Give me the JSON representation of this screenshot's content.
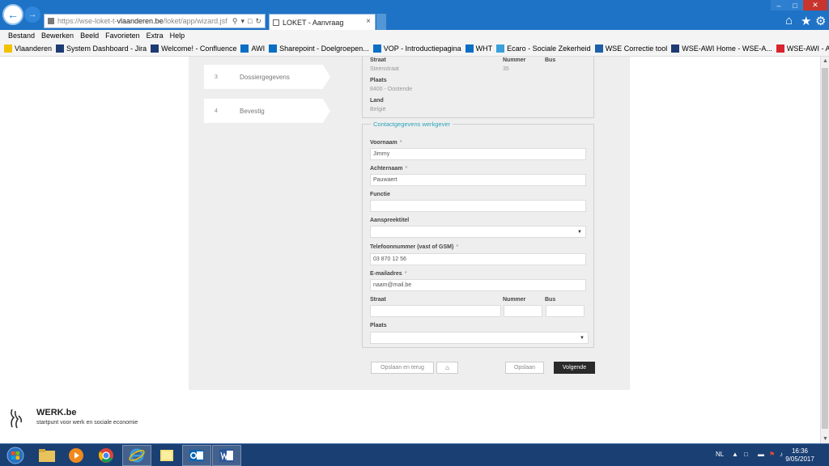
{
  "browser": {
    "url_prefix": "https://wse-loket-t-",
    "url_domain": "vlaanderen.be",
    "url_path": "/loket/app/wizard.jsf",
    "tab_title": "LOKET - Aanvraag",
    "tab_close": "×",
    "window_controls": {
      "minimize": "–",
      "maximize": "□",
      "close": "✕"
    }
  },
  "menu": [
    "Bestand",
    "Bewerken",
    "Beeld",
    "Favorieten",
    "Extra",
    "Help"
  ],
  "favorites": [
    {
      "label": "Vlaanderen",
      "icon": "lion-icon",
      "color": "#f2c200"
    },
    {
      "label": "System Dashboard - Jira",
      "icon": "jira-icon",
      "color": "#1f3b73"
    },
    {
      "label": "Welcome! - Confluence",
      "icon": "confluence-icon",
      "color": "#1f3b73"
    },
    {
      "label": "AWI",
      "icon": "sharepoint-icon",
      "color": "#0b6fc4"
    },
    {
      "label": "Sharepoint - Doelgroepen...",
      "icon": "sharepoint-icon",
      "color": "#0b6fc4"
    },
    {
      "label": "VOP - Introductiepagina",
      "icon": "sharepoint-icon",
      "color": "#0b6fc4"
    },
    {
      "label": "WHT",
      "icon": "sharepoint-icon",
      "color": "#0b6fc4"
    },
    {
      "label": "Ecaro - Sociale Zekerheid",
      "icon": "ecaro-icon",
      "color": "#3aa0d8"
    },
    {
      "label": "WSE Correctie tool",
      "icon": "wse-icon",
      "color": "#1e5fa8"
    },
    {
      "label": "WSE-AWI Home - WSE-A...",
      "icon": "confluence-icon",
      "color": "#1f3b73"
    },
    {
      "label": "WSE-AWI - Agile Board - ...",
      "icon": "agile-icon",
      "color": "#d9232d"
    }
  ],
  "steps": [
    {
      "num": "3",
      "label": "Dossiergegevens"
    },
    {
      "num": "4",
      "label": "Bevestig"
    }
  ],
  "address": {
    "straat_label": "Straat",
    "straat_value": "Steenstraat",
    "nummer_label": "Nummer",
    "nummer_value": "35",
    "bus_label": "Bus",
    "plaats_label": "Plaats",
    "plaats_value": "8400 - Oostende",
    "land_label": "Land",
    "land_value": "België"
  },
  "contact": {
    "legend": "Contactgegevens werkgever",
    "required_mark": "*",
    "voornaam_label": "Voornaam",
    "voornaam_value": "Jimmy",
    "achternaam_label": "Achternaam",
    "achternaam_value": "Pauwaert",
    "functie_label": "Functie",
    "functie_value": "",
    "aanspreektitel_label": "Aanspreektitel",
    "aanspreektitel_value": "",
    "telefoon_label": "Telefoonnummer (vast of GSM)",
    "telefoon_value": "03 870 12 56",
    "email_label": "E-mailadres",
    "email_value": "naam@mail.be",
    "straat_label": "Straat",
    "nummer_label": "Nummer",
    "bus_label": "Bus",
    "plaats_label": "Plaats",
    "plaats_value": ""
  },
  "buttons": {
    "opslaan_terug": "Opslaan en terug",
    "opslaan": "Opslaan",
    "volgende": "Volgende"
  },
  "footer": {
    "title": "WERK.be",
    "subtitle": "startpunt voor werk en sociale economie"
  },
  "taskbar": {
    "language": "NL",
    "time": "16:36",
    "date": "9/05/2017"
  }
}
